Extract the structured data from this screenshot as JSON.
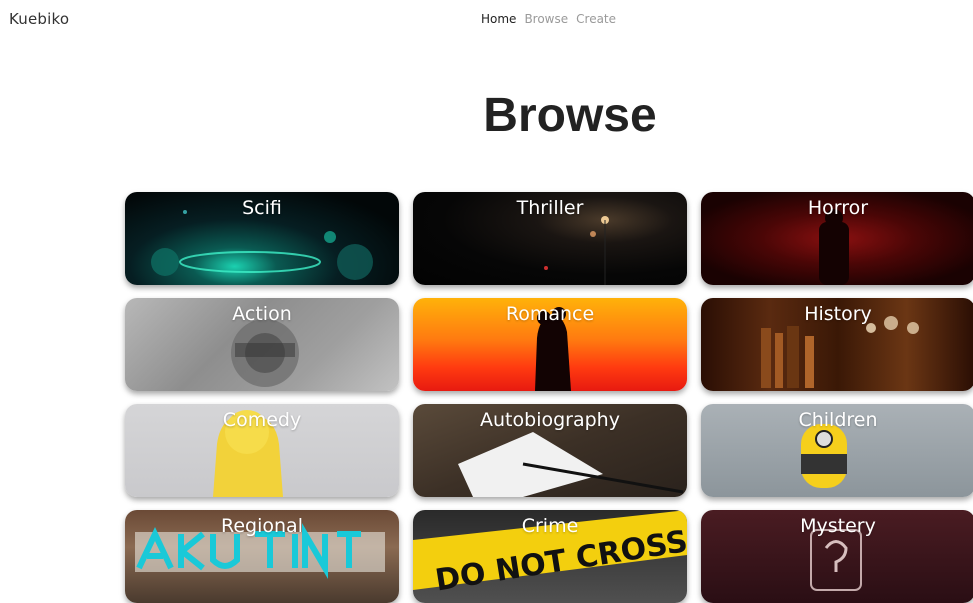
{
  "header": {
    "brand": "Kuebiko",
    "nav": [
      {
        "label": "Home",
        "active": true
      },
      {
        "label": "Browse",
        "active": false
      },
      {
        "label": "Create",
        "active": false
      }
    ]
  },
  "page": {
    "title": "Browse"
  },
  "categories": [
    {
      "label": "Scifi"
    },
    {
      "label": "Thriller"
    },
    {
      "label": "Horror"
    },
    {
      "label": "Action"
    },
    {
      "label": "Romance"
    },
    {
      "label": "History"
    },
    {
      "label": "Comedy"
    },
    {
      "label": "Autobiography"
    },
    {
      "label": "Children"
    },
    {
      "label": "Regional"
    },
    {
      "label": "Crime"
    },
    {
      "label": "Mystery"
    }
  ]
}
